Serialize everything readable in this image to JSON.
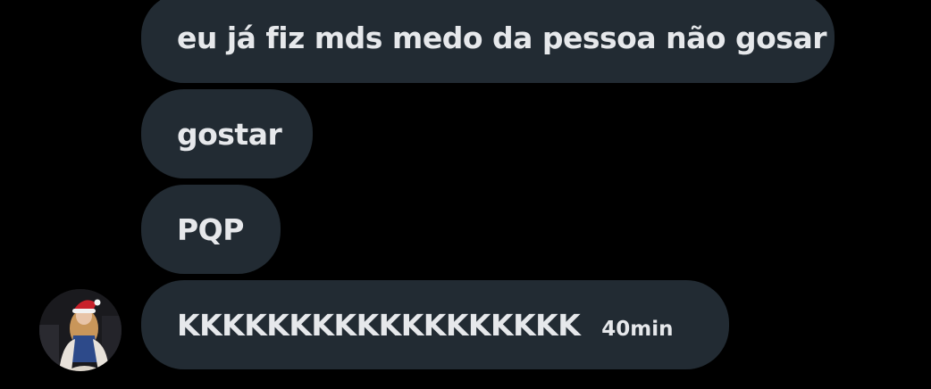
{
  "conversation": {
    "messages": [
      {
        "text": "eu já fiz mds medo da pessoa não gosar"
      },
      {
        "text": "gostar"
      },
      {
        "text": "PQP"
      },
      {
        "text": "KKKKKKKKKKKKKKKKKK",
        "timestamp": "40min"
      }
    ]
  },
  "avatar": {
    "icon": "user-avatar-photo",
    "colors": {
      "background": "#1a1a1e",
      "hat": "#c8202a",
      "hair": "#c9965a",
      "dress": "#2d4a8a",
      "fur": "#e8e2da"
    }
  },
  "colors": {
    "page_background": "#000000",
    "bubble": "#222b33",
    "text": "#e6e8eb"
  }
}
